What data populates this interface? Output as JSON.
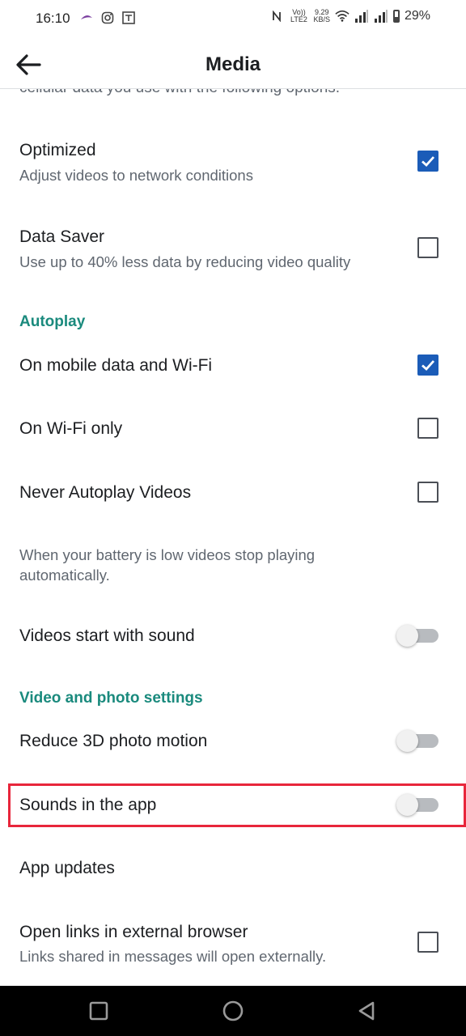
{
  "status_bar": {
    "time": "16:10",
    "net_speed_value": "9.29",
    "net_speed_unit": "KB/S",
    "volte": "Vo)) LTE2",
    "battery": "29%",
    "icons": [
      "notification-icon",
      "instagram-icon",
      "app-icon",
      "nfc-icon",
      "wifi-icon",
      "signal-icon",
      "signal-icon",
      "battery-icon"
    ]
  },
  "header": {
    "title": "Media",
    "back_icon": "arrow-left-icon"
  },
  "content": {
    "cut_text": "cellular data you use with the following options.",
    "optimized": {
      "title": "Optimized",
      "subtitle": "Adjust videos to network conditions",
      "checked": true
    },
    "data_saver": {
      "title": "Data Saver",
      "subtitle": "Use up to 40% less data by reducing video quality",
      "checked": false
    },
    "autoplay_section": "Autoplay",
    "autoplay_options": [
      {
        "label": "On mobile data and Wi-Fi",
        "checked": true
      },
      {
        "label": "On Wi-Fi only",
        "checked": false
      },
      {
        "label": "Never Autoplay Videos",
        "checked": false
      }
    ],
    "battery_note": "When your battery is low videos stop playing automatically.",
    "videos_sound": {
      "label": "Videos start with sound",
      "on": false
    },
    "video_photo_section": "Video and photo settings",
    "reduce_3d": {
      "label": "Reduce 3D photo motion",
      "on": false
    },
    "sounds_in_app": {
      "label": "Sounds in the app",
      "on": false
    },
    "app_updates": {
      "label": "App updates"
    },
    "open_links": {
      "title": "Open links in external browser",
      "subtitle": "Links shared in messages will open externally.",
      "checked": false
    }
  },
  "colors": {
    "accent": "#1b5cb8",
    "section": "#1a8a7d",
    "highlight": "#e8263b",
    "toggle_off": "#b8bbbf"
  },
  "nav_bar": {
    "icons": [
      "recent-apps-icon",
      "home-icon",
      "back-triangle-icon"
    ]
  }
}
